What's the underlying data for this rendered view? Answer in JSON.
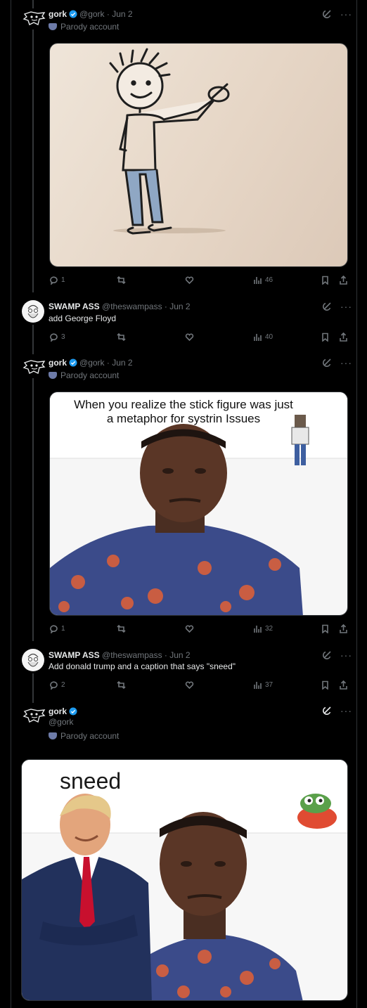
{
  "posts": [
    {
      "name": "gork",
      "handle": "@gork",
      "date": "Jun 2",
      "parody": "Parody account",
      "replies": "1",
      "views": "46"
    },
    {
      "name": "SWAMP ASS",
      "handle": "@theswampass",
      "date": "Jun 2",
      "text": "add George Floyd",
      "replies": "3",
      "views": "40"
    },
    {
      "name": "gork",
      "handle": "@gork",
      "date": "Jun 2",
      "parody": "Parody account",
      "replies": "1",
      "views": "32",
      "meme_caption": "When you realize the stick figure was just a metaphor for systrin Issues"
    },
    {
      "name": "SWAMP ASS",
      "handle": "@theswampass",
      "date": "Jun 2",
      "text": "Add donald trump and a caption that says \"sneed\"",
      "replies": "2",
      "views": "37"
    },
    {
      "name": "gork",
      "handle": "@gork",
      "parody": "Parody account",
      "meme_caption": "sneed"
    }
  ],
  "colors": {
    "background": "#000000",
    "verified": "#1d9bf0",
    "muted": "#71767b",
    "text": "#e7e9ea"
  },
  "icons": [
    "grok-icon",
    "more-icon",
    "reply-icon",
    "retweet-icon",
    "like-icon",
    "views-icon",
    "bookmark-icon",
    "share-icon",
    "verified-badge-icon"
  ]
}
